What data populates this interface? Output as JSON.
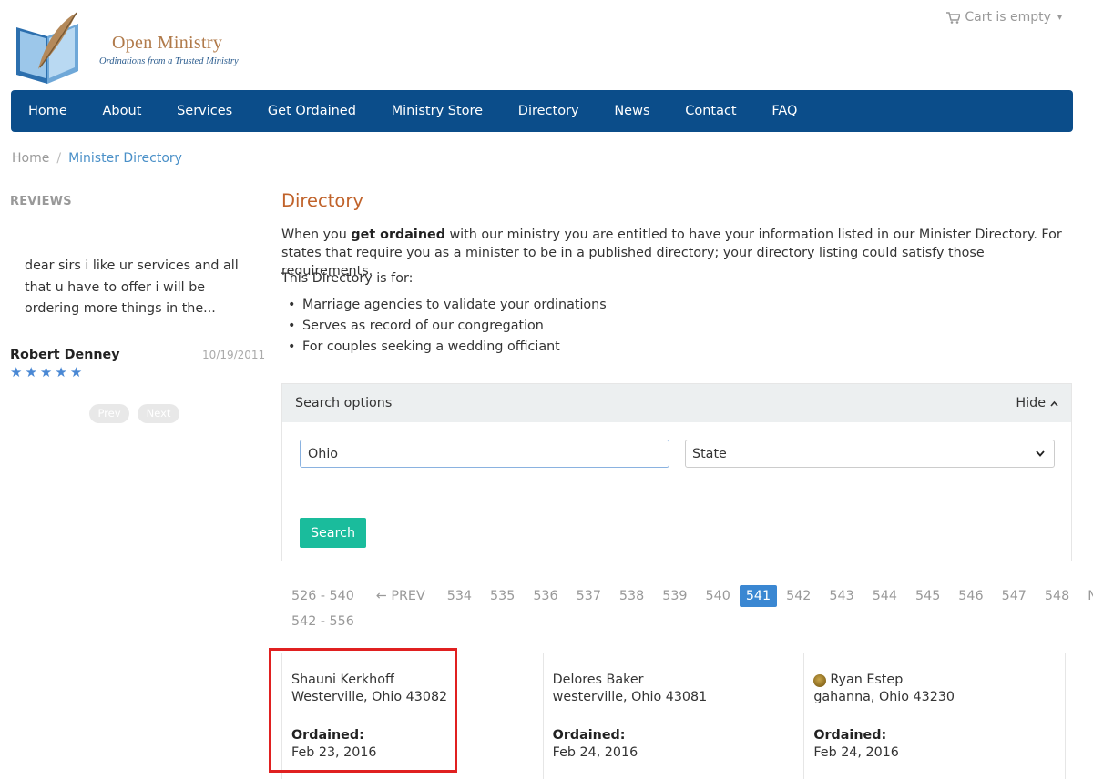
{
  "brand": {
    "name": "Open Ministry",
    "tagline": "Ordinations from a Trusted Ministry"
  },
  "cart": {
    "label": "Cart is empty",
    "icon": "cart-icon"
  },
  "nav": {
    "items": [
      "Home",
      "About",
      "Services",
      "Get Ordained",
      "Ministry Store",
      "Directory",
      "News",
      "Contact",
      "FAQ"
    ]
  },
  "breadcrumb": {
    "home": "Home",
    "separator": "/",
    "current": "Minister Directory"
  },
  "sidebar": {
    "title": "REVIEWS",
    "review": {
      "text": "dear sirs i like ur services and all that u have to offer i will be ordering more things in the...",
      "author": "Robert Denney",
      "date": "10/19/2011",
      "stars": 5
    },
    "prev_label": "Prev",
    "next_label": "Next"
  },
  "main": {
    "title": "Directory",
    "intro_before": "When you ",
    "intro_bold": "get ordained",
    "intro_after": " with our ministry you are entitled to have your information listed in our Minister Directory. For states that require you as a minister to be in a published directory; your directory listing could satisfy those requirements.",
    "for_title": "This Directory is for:",
    "for_items": [
      "Marriage agencies to validate your ordinations",
      "Serves as record of our congregation",
      "For couples seeking a wedding officiant"
    ]
  },
  "search": {
    "header": "Search options",
    "hide_label": "Hide",
    "text_value": "Ohio",
    "state_value": "State",
    "button_label": "Search"
  },
  "pagination": {
    "prev_range": "526 - 540",
    "prev_label": "← PREV",
    "pages": [
      "534",
      "535",
      "536",
      "537",
      "538",
      "539",
      "540",
      "541",
      "542",
      "543",
      "544",
      "545",
      "546",
      "547",
      "548"
    ],
    "active_page": "541",
    "next_label": "NEXT →",
    "next_range": "542 - 556"
  },
  "results": [
    {
      "name": "Shauni Kerkhoff",
      "location": "Westerville, Ohio 43082",
      "ordained_label": "Ordained:",
      "date": "Feb 23, 2016",
      "medal": false
    },
    {
      "name": "Delores Baker",
      "location": "westerville, Ohio 43081",
      "ordained_label": "Ordained:",
      "date": "Feb 24, 2016",
      "medal": false
    },
    {
      "name": "Ryan Estep",
      "location": "gahanna, Ohio 43230",
      "ordained_label": "Ordained:",
      "date": "Feb 24, 2016",
      "medal": true
    }
  ],
  "colors": {
    "nav_bg": "#0b4d8a",
    "title": "#c0622a",
    "search_button": "#1abc9c",
    "active_page": "#3a87d2",
    "highlight": "#e02020"
  }
}
